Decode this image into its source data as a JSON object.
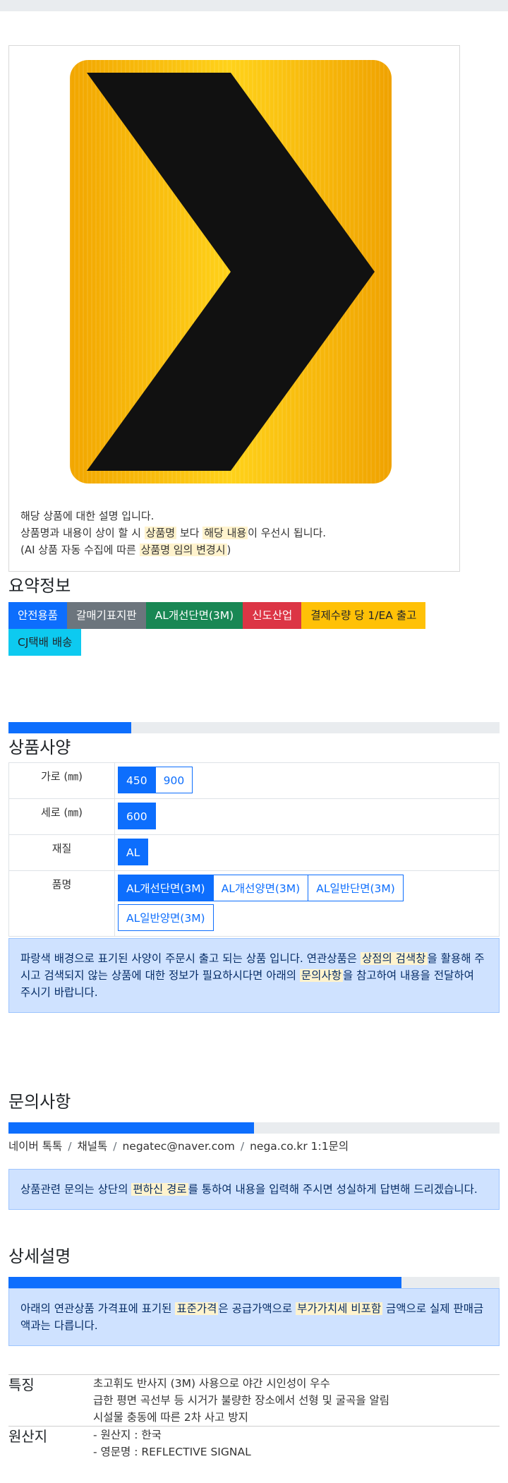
{
  "image_desc": {
    "line1": "해당 상품에 대한 설명 입니다.",
    "line2_a": "상품명과 내용이 상이 할 시 ",
    "line2_hl1": "상품명",
    "line2_b": " 보다 ",
    "line2_hl2": "해당 내용",
    "line2_c": "이 우선시 됩니다.",
    "line3_a": "(AI 상품 자동 수집에 따른 ",
    "line3_hl": "상품명 임의 변경시",
    "line3_b": ")"
  },
  "summary": {
    "title": "요약정보",
    "badges": [
      {
        "label": "안전용품",
        "color": "#0d6efd"
      },
      {
        "label": "갈매기표지판",
        "color": "#6c757d"
      },
      {
        "label": "AL개선단면(3M)",
        "color": "#198754"
      },
      {
        "label": "신도산업",
        "color": "#dc3545"
      },
      {
        "label": "결제수량 당 1/EA 출고",
        "color": "#ffc107"
      },
      {
        "label": "CJ택배 배송",
        "color": "#0dcaf0"
      }
    ]
  },
  "spec": {
    "progress": 0.25,
    "title": "상품사양",
    "rows": [
      {
        "label": "가로 (㎜)",
        "options": [
          "450",
          "900"
        ],
        "active": 0
      },
      {
        "label": "세로 (㎜)",
        "options": [
          "600"
        ],
        "active": 0
      },
      {
        "label": "재질",
        "options": [
          "AL"
        ],
        "active": 0
      },
      {
        "label": "품명",
        "options": [
          "AL개선단면(3M)",
          "AL개선양면(3M)",
          "AL일반단면(3M)",
          "AL일반양면(3M)"
        ],
        "active": 0
      }
    ],
    "notice_a": "파랑색 배경으로 표기된 사양이 주문시 출고 되는 상품 입니다. 연관상품은 ",
    "notice_hl1": "상점의 검색창",
    "notice_b": "을 활용해 주시고 검색되지 않는 상품에 대한 정보가 필요하시다면 아래의 ",
    "notice_hl2": "문의사항",
    "notice_c": "을 참고하여 내용을 전달하여 주시기 바랍니다."
  },
  "inquiry": {
    "title": "문의사항",
    "progress": 0.5,
    "links": [
      "네이버 톡톡",
      "채널톡",
      "negatec@naver.com",
      "nega.co.kr 1:1문의"
    ],
    "notice_a": "상품관련 문의는 상단의 ",
    "notice_hl": "편하신 경로",
    "notice_b": "를 통하여 내용을 입력해 주시면 성실하게 답변해 드리겠습니다."
  },
  "detail": {
    "title": "상세설명",
    "progress": 0.8,
    "notice_a": "아래의 연관상품 가격표에 표기된 ",
    "notice_hl1": "표준가격",
    "notice_b": "은 공급가액으로 ",
    "notice_hl2": "부가가치세 비포함",
    "notice_c": " 금액으로 실제 판매금액과는 다릅니다.",
    "features": [
      {
        "key": "특징",
        "lines": [
          "초고휘도 반사지 (3M) 사용으로 야간 시인성이 우수",
          "급한 평면 곡선부 등 시거가 불량한 장소에서 선형 및 굴곡을 알림",
          "시설물 충동에 따른 2차 사고 방지"
        ]
      },
      {
        "key": "원산지",
        "lines": [
          "- 원산지 : 한국",
          "- 영문명 : REFLECTIVE SIGNAL"
        ]
      }
    ]
  },
  "colors": {
    "sign_yellow": "#f7b500",
    "sign_black": "#111111"
  }
}
